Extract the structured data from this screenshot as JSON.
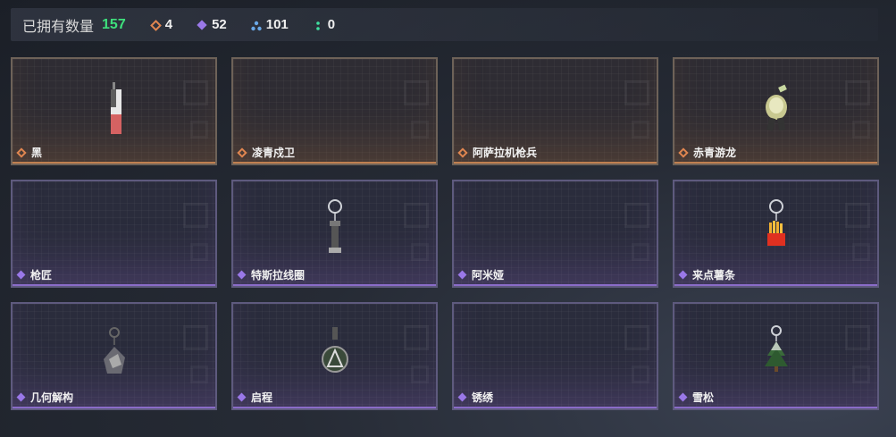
{
  "header": {
    "owned_label": "已拥有数量",
    "owned_count": "157",
    "stats": [
      {
        "icon": "orange-diamond-icon",
        "value": "4"
      },
      {
        "icon": "purple-diamond-icon",
        "value": "52"
      },
      {
        "icon": "blue-triangle-icon",
        "value": "101"
      },
      {
        "icon": "green-dots-icon",
        "value": "0"
      }
    ]
  },
  "colors": {
    "owned": "#3ee07c",
    "gold": "#e08650",
    "purple": "#9a78e8"
  },
  "items": [
    {
      "name": "黑",
      "rarity": "gold",
      "art": "cigarette-charm"
    },
    {
      "name": "凌青戍卫",
      "rarity": "gold",
      "art": ""
    },
    {
      "name": "阿萨拉机枪兵",
      "rarity": "gold",
      "art": ""
    },
    {
      "name": "赤青游龙",
      "rarity": "gold",
      "art": "dragon-figure"
    },
    {
      "name": "枪匠",
      "rarity": "purple",
      "art": ""
    },
    {
      "name": "特斯拉线圈",
      "rarity": "purple",
      "art": "tesla-coil-charm"
    },
    {
      "name": "阿米娅",
      "rarity": "purple",
      "art": ""
    },
    {
      "name": "来点薯条",
      "rarity": "purple",
      "art": "fries-charm"
    },
    {
      "name": "几何解构",
      "rarity": "purple",
      "art": "geometry-charm"
    },
    {
      "name": "启程",
      "rarity": "purple",
      "art": "medallion-charm"
    },
    {
      "name": "锈绣",
      "rarity": "purple",
      "art": ""
    },
    {
      "name": "雪松",
      "rarity": "purple",
      "art": "pine-tree-charm"
    }
  ]
}
